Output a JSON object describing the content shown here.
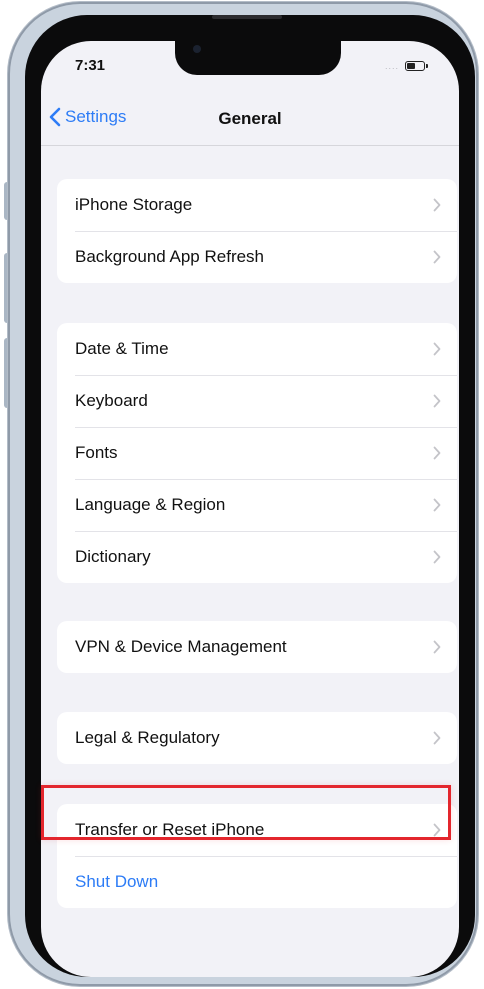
{
  "status_bar": {
    "time": "7:31",
    "signal_dots": "....",
    "battery_level": 0.55,
    "battery_icon": "battery-icon"
  },
  "nav": {
    "back_label": "Settings",
    "back_icon": "chevron-left-icon",
    "title": "General"
  },
  "groups": [
    {
      "items": [
        {
          "label": "iPhone Storage"
        },
        {
          "label": "Background App Refresh"
        }
      ]
    },
    {
      "items": [
        {
          "label": "Date & Time"
        },
        {
          "label": "Keyboard"
        },
        {
          "label": "Fonts"
        },
        {
          "label": "Language & Region"
        },
        {
          "label": "Dictionary"
        }
      ]
    },
    {
      "items": [
        {
          "label": "VPN & Device Management"
        }
      ]
    },
    {
      "items": [
        {
          "label": "Legal & Regulatory"
        }
      ]
    },
    {
      "items": [
        {
          "label": "Transfer or Reset iPhone"
        },
        {
          "label": "Shut Down"
        }
      ]
    }
  ],
  "highlighted_item": "Transfer or Reset iPhone",
  "colors": {
    "accent": "#2d7cf6",
    "highlight": "#e3262d",
    "background": "#f2f2f7"
  }
}
